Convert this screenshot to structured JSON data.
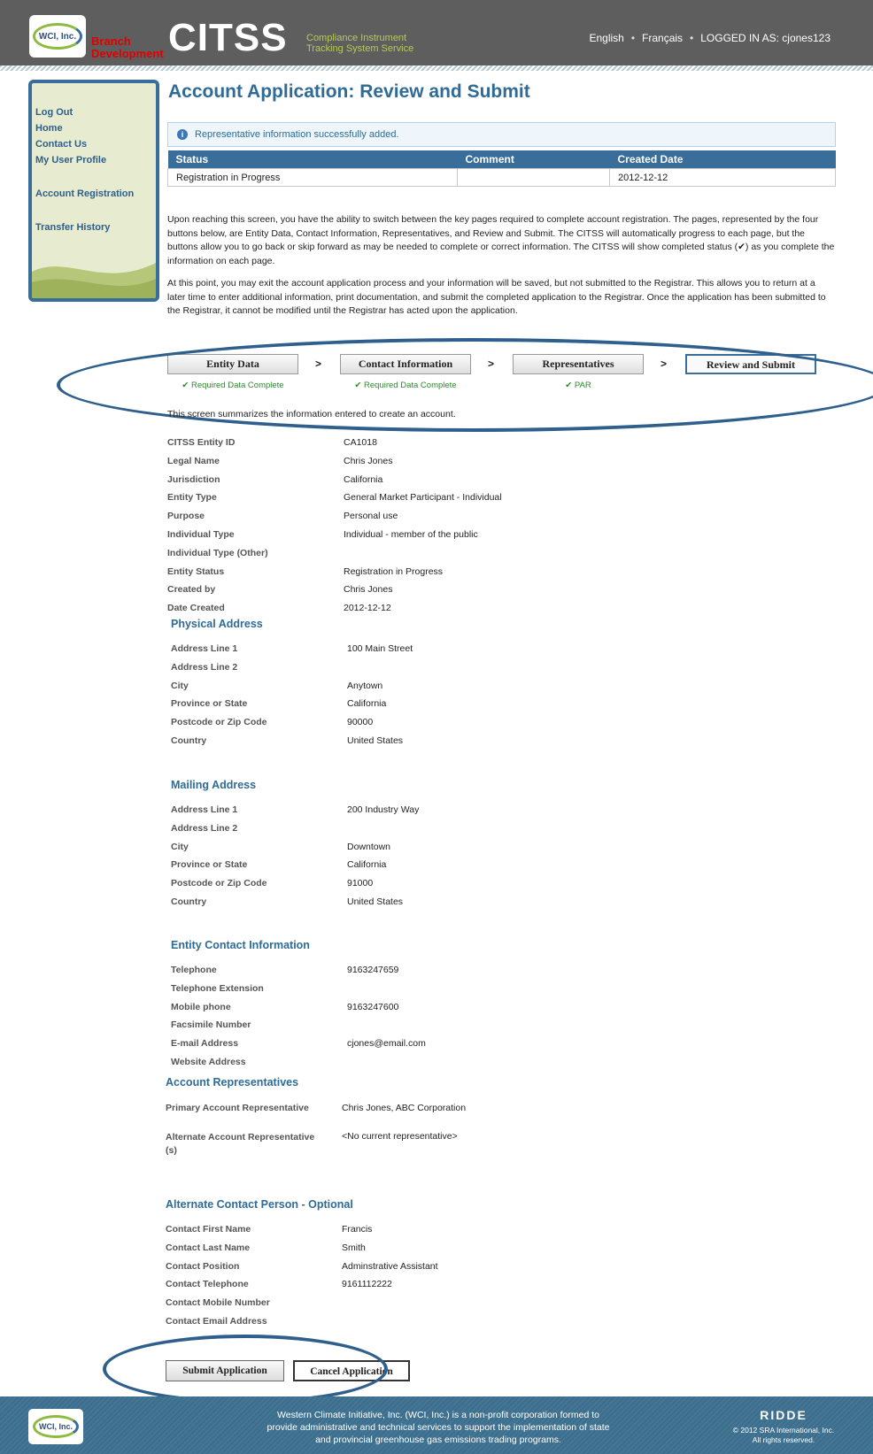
{
  "header": {
    "logo_text": "WCI, Inc.",
    "branch_line1": "Branch",
    "branch_line2": "Development",
    "app_name": "CITSS",
    "app_sub1": "Compliance Instrument",
    "app_sub2": "Tracking System Service",
    "lang_en": "English",
    "lang_fr": "Français",
    "sep": "•",
    "logged_in": "LOGGED IN AS:  cjones123"
  },
  "sidebar": {
    "items": [
      "Log Out",
      "Home",
      "Contact Us",
      "My User Profile",
      "Account Registration",
      "Transfer History"
    ]
  },
  "page": {
    "title": "Account Application: Review and Submit",
    "info_message": "Representative information successfully added."
  },
  "status_table": {
    "headers": [
      "Status",
      "Comment",
      "Created Date"
    ],
    "row": [
      "Registration in Progress",
      "",
      "2012-12-12"
    ]
  },
  "paragraphs": [
    "Upon reaching this screen, you have the ability to switch between the key pages required to complete account registration. The pages, represented by the four buttons below, are Entity Data, Contact Information, Representatives, and Review and Submit. The CITSS will automatically progress to each page, but the buttons allow you to go back or skip forward as may be needed to complete or correct information. The CITSS will show completed status (✔) as you complete the information on each page.",
    "At this point, you may exit the account application process and your information will be saved, but not submitted to the Registrar. This allows you to return at a later time to enter additional information, print documentation, and submit the completed application to the Registrar. Once the application has been submitted to the Registrar, it cannot be modified until the Registrar has acted upon the application."
  ],
  "steps": [
    {
      "label": "Entity Data",
      "status": "✔ Required Data Complete"
    },
    {
      "label": "Contact Information",
      "status": "✔ Required Data Complete"
    },
    {
      "label": "Representatives",
      "status": "✔  PAR"
    },
    {
      "label": "Review and Submit",
      "status": ""
    }
  ],
  "step_arrow": ">",
  "summary_intro": "This screen summarizes the information entered to create an account.",
  "entity": [
    {
      "label": "CITSS Entity ID",
      "value": "CA1018"
    },
    {
      "label": "Legal Name",
      "value": "Chris Jones"
    },
    {
      "label": "Jurisdiction",
      "value": "California"
    },
    {
      "label": "Entity Type",
      "value": "General Market Participant - Individual"
    },
    {
      "label": "Purpose",
      "value": "Personal use"
    },
    {
      "label": "Individual Type",
      "value": "Individual - member of the public"
    },
    {
      "label": "Individual Type (Other)",
      "value": ""
    },
    {
      "label": "Entity Status",
      "value": "Registration in Progress"
    },
    {
      "label": "Created by",
      "value": "Chris Jones"
    },
    {
      "label": "Date Created",
      "value": "2012-12-12"
    }
  ],
  "physical_address": {
    "title": "Physical Address",
    "rows": [
      {
        "label": "Address Line 1",
        "value": "100 Main Street"
      },
      {
        "label": "Address Line 2",
        "value": ""
      },
      {
        "label": "City",
        "value": "Anytown"
      },
      {
        "label": "Province or State",
        "value": "California"
      },
      {
        "label": "Postcode or Zip Code",
        "value": "90000"
      },
      {
        "label": "Country",
        "value": "United States"
      }
    ]
  },
  "mailing_address": {
    "title": "Mailing Address",
    "rows": [
      {
        "label": "Address Line 1",
        "value": "200 Industry Way"
      },
      {
        "label": "Address Line 2",
        "value": ""
      },
      {
        "label": "City",
        "value": "Downtown"
      },
      {
        "label": "Province or State",
        "value": "California"
      },
      {
        "label": "Postcode or Zip Code",
        "value": "91000"
      },
      {
        "label": "Country",
        "value": "United States"
      }
    ]
  },
  "entity_contact": {
    "title": "Entity Contact Information",
    "rows": [
      {
        "label": "Telephone",
        "value": "9163247659"
      },
      {
        "label": "Telephone Extension",
        "value": ""
      },
      {
        "label": "Mobile phone",
        "value": "9163247600"
      },
      {
        "label": "Facsimile Number",
        "value": ""
      },
      {
        "label": "E-mail Address",
        "value": "cjones@email.com"
      },
      {
        "label": "Website Address",
        "value": ""
      }
    ]
  },
  "representatives": {
    "title": "Account Representatives",
    "primary_label": "Primary Account Representative",
    "primary_value": "Chris Jones, ABC Corporation",
    "alternate_label_1": "Alternate Account Representative",
    "alternate_label_2": "(s)",
    "alternate_value": "<No current representative>"
  },
  "alt_contact": {
    "title": "Alternate Contact Person - Optional",
    "rows": [
      {
        "label": "Contact First Name",
        "value": "Francis"
      },
      {
        "label": "Contact Last Name",
        "value": "Smith"
      },
      {
        "label": "Contact Position",
        "value": "Adminstrative Assistant"
      },
      {
        "label": "Contact Telephone",
        "value": "9161112222"
      },
      {
        "label": "Contact Mobile Number",
        "value": ""
      },
      {
        "label": "Contact Email Address",
        "value": ""
      }
    ]
  },
  "buttons": {
    "submit": "Submit Application",
    "cancel": "Cancel Application"
  },
  "footer": {
    "logo_text": "WCI, Inc.",
    "text": "Western Climate Initiative, Inc. (WCI, Inc.) is a non-profit corporation formed to provide administrative and technical services to support the implementation of state and provincial greenhouse gas emissions trading programs.",
    "sra_logo": "RIDDE",
    "copyright_1": "© 2012 SRA International, Inc.",
    "copyright_2": "All rights reserved."
  },
  "colors": {
    "header_bg": "#5e5e5e",
    "accent": "#3a6e9a",
    "title": "#2e6b96",
    "success": "#2b8a2b",
    "sidebar_bg": "#e7ecd0",
    "footer_bg": "#3a6e8d"
  }
}
